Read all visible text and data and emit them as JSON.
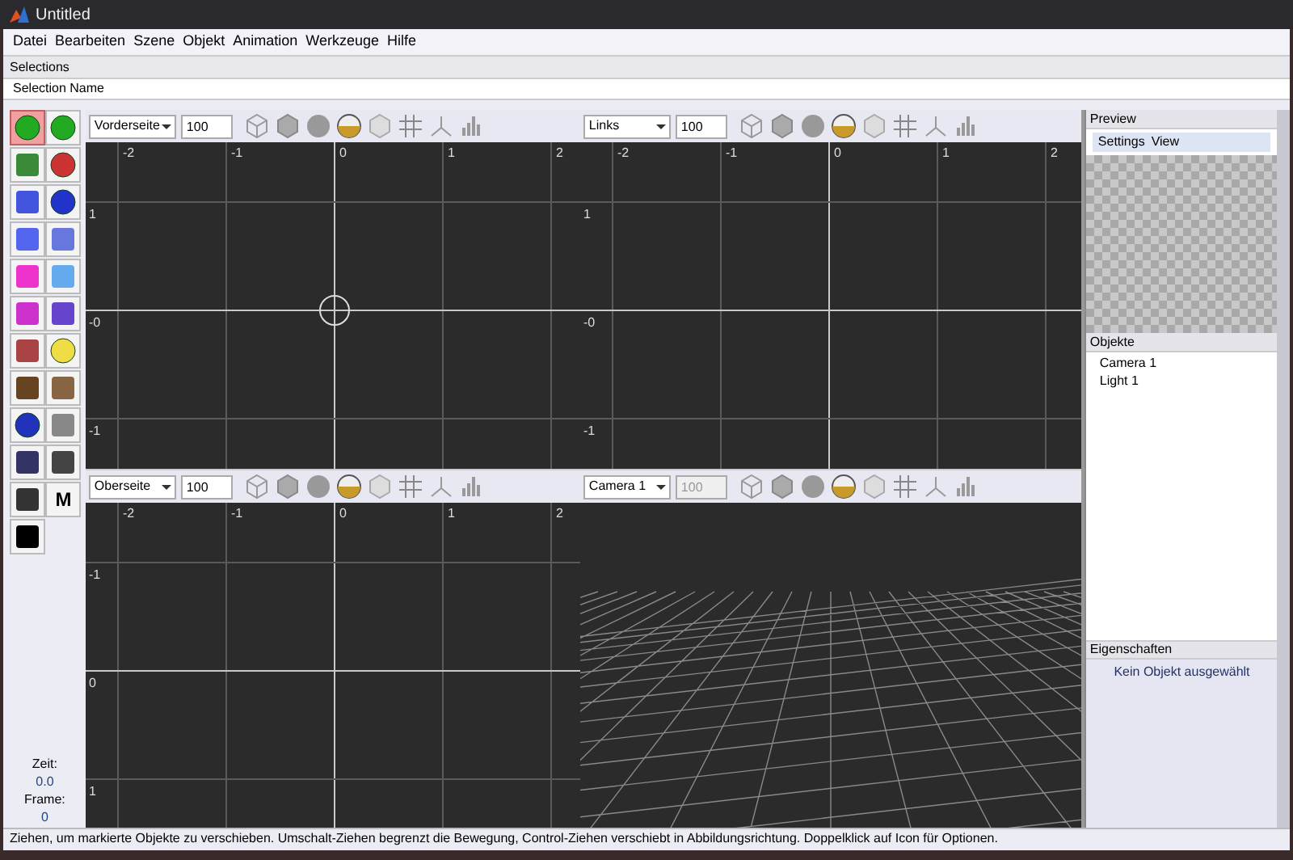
{
  "window": {
    "title": "Untitled"
  },
  "menu": [
    "Datei",
    "Bearbeiten",
    "Szene",
    "Objekt",
    "Animation",
    "Werkzeuge",
    "Hilfe"
  ],
  "selections": {
    "title": "Selections",
    "name_label": "Selection Name"
  },
  "tools": [
    {
      "selected": true
    },
    {
      "selected": false
    },
    {
      "selected": false
    },
    {
      "selected": false
    },
    {
      "selected": false
    },
    {
      "selected": false
    },
    {
      "selected": false
    },
    {
      "selected": false
    },
    {
      "selected": false
    },
    {
      "selected": false
    },
    {
      "selected": false
    },
    {
      "selected": false
    },
    {
      "selected": false
    },
    {
      "selected": false
    },
    {
      "selected": false
    },
    {
      "selected": false
    },
    {
      "selected": false
    },
    {
      "selected": false
    },
    {
      "selected": false
    },
    {
      "selected": false
    },
    {
      "selected": false
    },
    {
      "selected": false
    },
    {
      "selected": false
    }
  ],
  "m_tool_label": "M",
  "time": {
    "zeit_label": "Zeit:",
    "zeit": "0.0",
    "frame_label": "Frame:",
    "frame": "0"
  },
  "viewports": [
    {
      "kind": "ortho",
      "view": "Vorderseite",
      "zoom": "100",
      "zoom_disabled": false,
      "object_marker": true,
      "x_labels": [
        "-2",
        "-1",
        "0",
        "1",
        "2"
      ],
      "y_labels": [
        "1",
        "-0",
        "-1"
      ]
    },
    {
      "kind": "ortho",
      "view": "Links",
      "zoom": "100",
      "zoom_disabled": false,
      "object_marker": false,
      "x_labels": [
        "-2",
        "-1",
        "0",
        "1",
        "2"
      ],
      "y_labels": [
        "1",
        "-0",
        "-1"
      ]
    },
    {
      "kind": "ortho",
      "view": "Oberseite",
      "zoom": "100",
      "zoom_disabled": false,
      "object_marker": false,
      "x_labels": [
        "-2",
        "-1",
        "0",
        "1",
        "2"
      ],
      "y_labels": [
        "-1",
        "0",
        "1"
      ]
    },
    {
      "kind": "perspective",
      "view": "Camera 1",
      "zoom": "100",
      "zoom_disabled": true
    }
  ],
  "preview": {
    "title": "Preview",
    "menu": [
      "Settings",
      "View"
    ]
  },
  "objects": {
    "title": "Objekte",
    "items": [
      "Camera 1",
      "Light 1"
    ]
  },
  "properties": {
    "title": "Eigenschaften",
    "message": "Kein Objekt ausgewählt"
  },
  "status_bar": "Ziehen, um markierte Objekte zu verschieben. Umschalt-Ziehen begrenzt die Bewegung, Control-Ziehen verschiebt in Abbildungsrichtung. Doppelklick auf Icon für Optionen."
}
